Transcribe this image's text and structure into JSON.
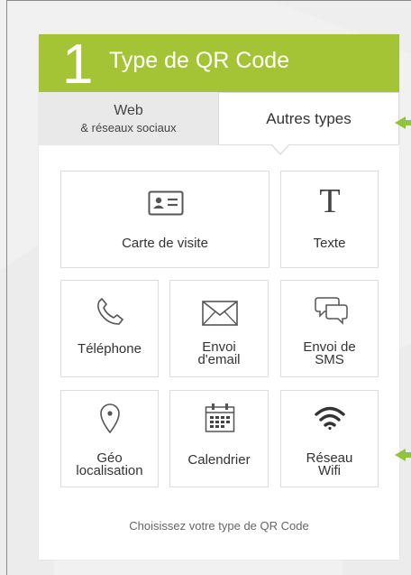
{
  "header": {
    "step_number": "1",
    "title": "Type de QR Code"
  },
  "tabs": {
    "web_line1": "Web",
    "web_line2": "& réseaux sociaux",
    "other": "Autres types"
  },
  "tiles": {
    "business_card": "Carte de visite",
    "text": "Texte",
    "phone": "Téléphone",
    "email_l1": "Envoi",
    "email_l2": "d'email",
    "sms_l1": "Envoi de",
    "sms_l2": "SMS",
    "geo_l1": "Géo",
    "geo_l2": "localisation",
    "calendar": "Calendrier",
    "wifi_l1": "Réseau",
    "wifi_l2": "Wifi"
  },
  "footer": "Choisissez votre type de QR Code",
  "colors": {
    "accent": "#a4c435",
    "text": "#333333",
    "muted": "#666666"
  },
  "icons": [
    "id-card-icon",
    "text-T-icon",
    "phone-icon",
    "envelope-icon",
    "chat-bubbles-icon",
    "map-pin-icon",
    "calendar-icon",
    "wifi-icon",
    "left-arrow-icon"
  ]
}
